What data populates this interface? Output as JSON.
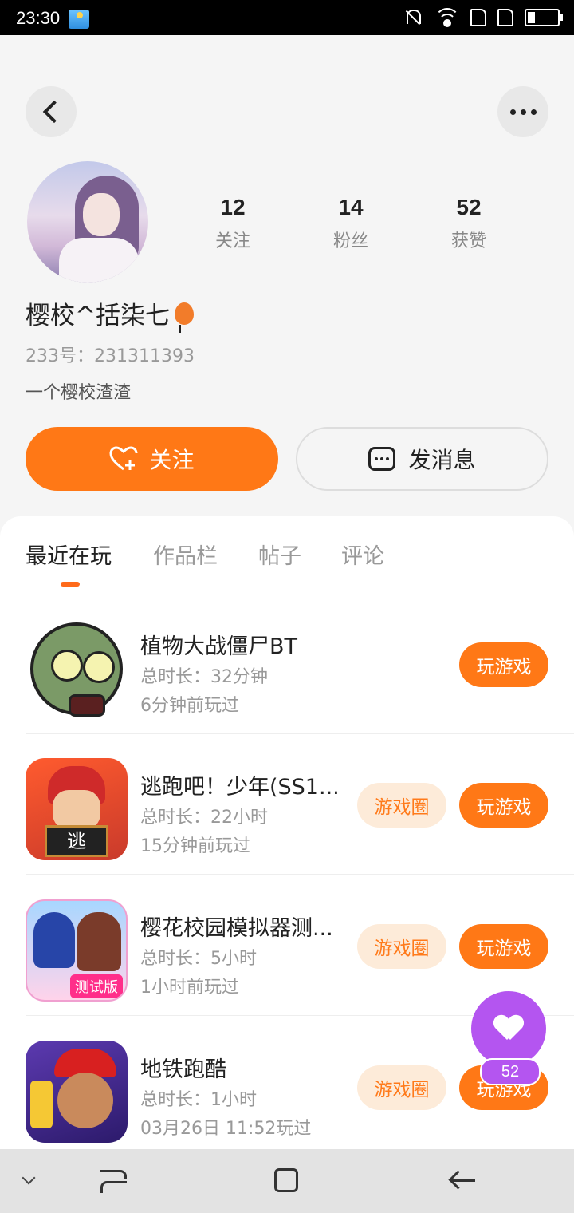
{
  "status_bar": {
    "time": "23:30"
  },
  "profile": {
    "nickname": "樱校^括柒七",
    "uid": "233号：231311393",
    "bio": "一个樱校渣渣",
    "stats": [
      {
        "count": "12",
        "label": "关注"
      },
      {
        "count": "14",
        "label": "粉丝"
      },
      {
        "count": "52",
        "label": "获赞"
      }
    ]
  },
  "actions": {
    "follow_label": "关注",
    "message_label": "发消息"
  },
  "tabs": [
    {
      "label": "最近在玩",
      "active": true
    },
    {
      "label": "作品栏",
      "active": false
    },
    {
      "label": "帖子",
      "active": false
    },
    {
      "label": "评论",
      "active": false
    }
  ],
  "games": [
    {
      "title": "植物大战僵尸BT",
      "duration": "总时长：32分钟",
      "last_played": "6分钟前玩过",
      "circle_label": "",
      "play_label": "玩游戏"
    },
    {
      "title": "逃跑吧！少年(SS1...",
      "duration": "总时长：22小时",
      "last_played": "15分钟前玩过",
      "circle_label": "游戏圈",
      "play_label": "玩游戏"
    },
    {
      "title": "樱花校园模拟器测...",
      "duration": "总时长：5小时",
      "last_played": "1小时前玩过",
      "circle_label": "游戏圈",
      "play_label": "玩游戏"
    },
    {
      "title": "地铁跑酷",
      "duration": "总时长：1小时",
      "last_played": "03月26日 11:52玩过",
      "circle_label": "游戏圈",
      "play_label": "玩游戏"
    }
  ],
  "game_icon_text": {
    "subway_board": "逃",
    "sakura_tag": "测试版"
  },
  "like_fab": {
    "count": "52"
  },
  "colors": {
    "accent": "#ff7816",
    "accent_light": "#fdebd9",
    "like_purple": "#b455f0"
  }
}
